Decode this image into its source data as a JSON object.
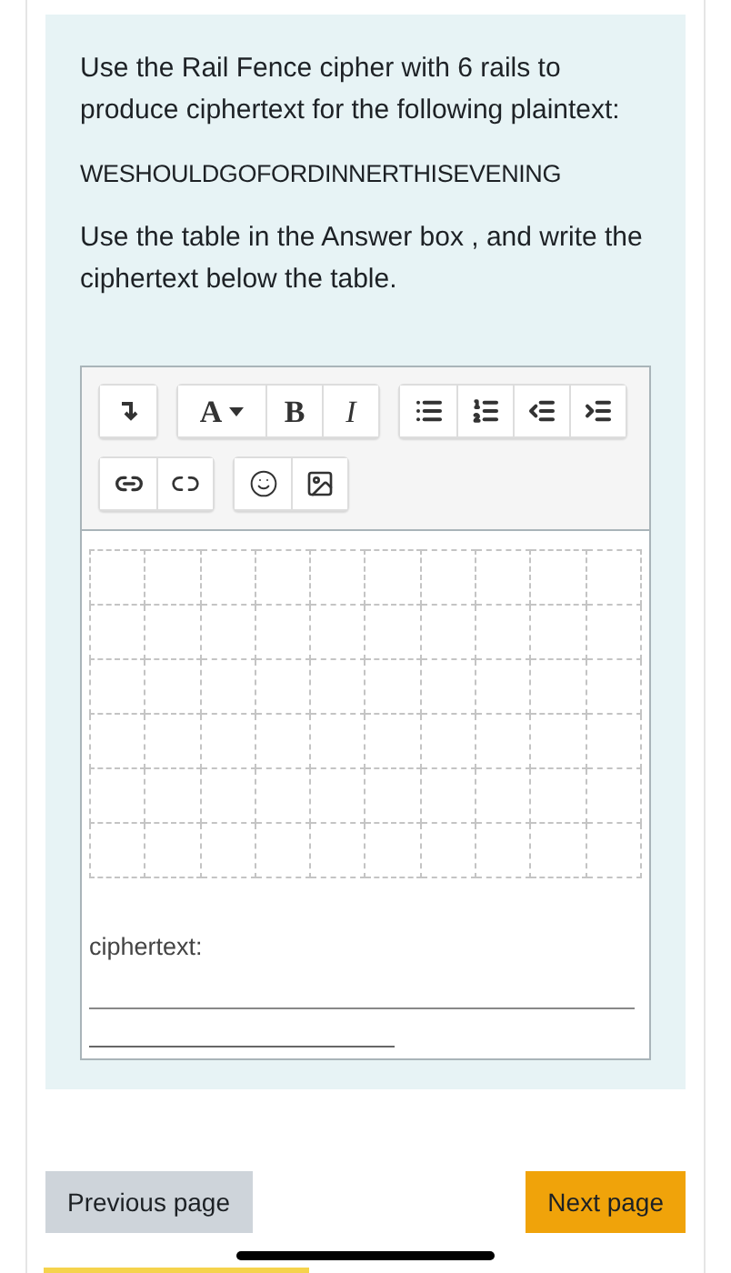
{
  "question": {
    "intro": "Use the Rail Fence cipher with 6 rails to produce ciphertext for the following plaintext:",
    "plaintext": "WESHOULDGOFORDINNERTHISEVENING",
    "instruction": "Use the table in the Answer box , and write the ciphertext below the table."
  },
  "toolbar": [
    [
      [
        {
          "kind": "collapse"
        }
      ],
      [
        {
          "kind": "font",
          "label": "A"
        },
        {
          "kind": "bold",
          "label": "B"
        },
        {
          "kind": "italic",
          "label": "I"
        }
      ],
      [
        {
          "kind": "bullets"
        },
        {
          "kind": "numbers"
        },
        {
          "kind": "outdent"
        },
        {
          "kind": "indent"
        }
      ]
    ],
    [
      [
        {
          "kind": "link"
        },
        {
          "kind": "unlink"
        }
      ],
      [
        {
          "kind": "emoji"
        },
        {
          "kind": "image"
        }
      ]
    ]
  ],
  "answer": {
    "label": "ciphertext:"
  },
  "buttons": {
    "previous": "Previous page",
    "next": "Next page"
  }
}
